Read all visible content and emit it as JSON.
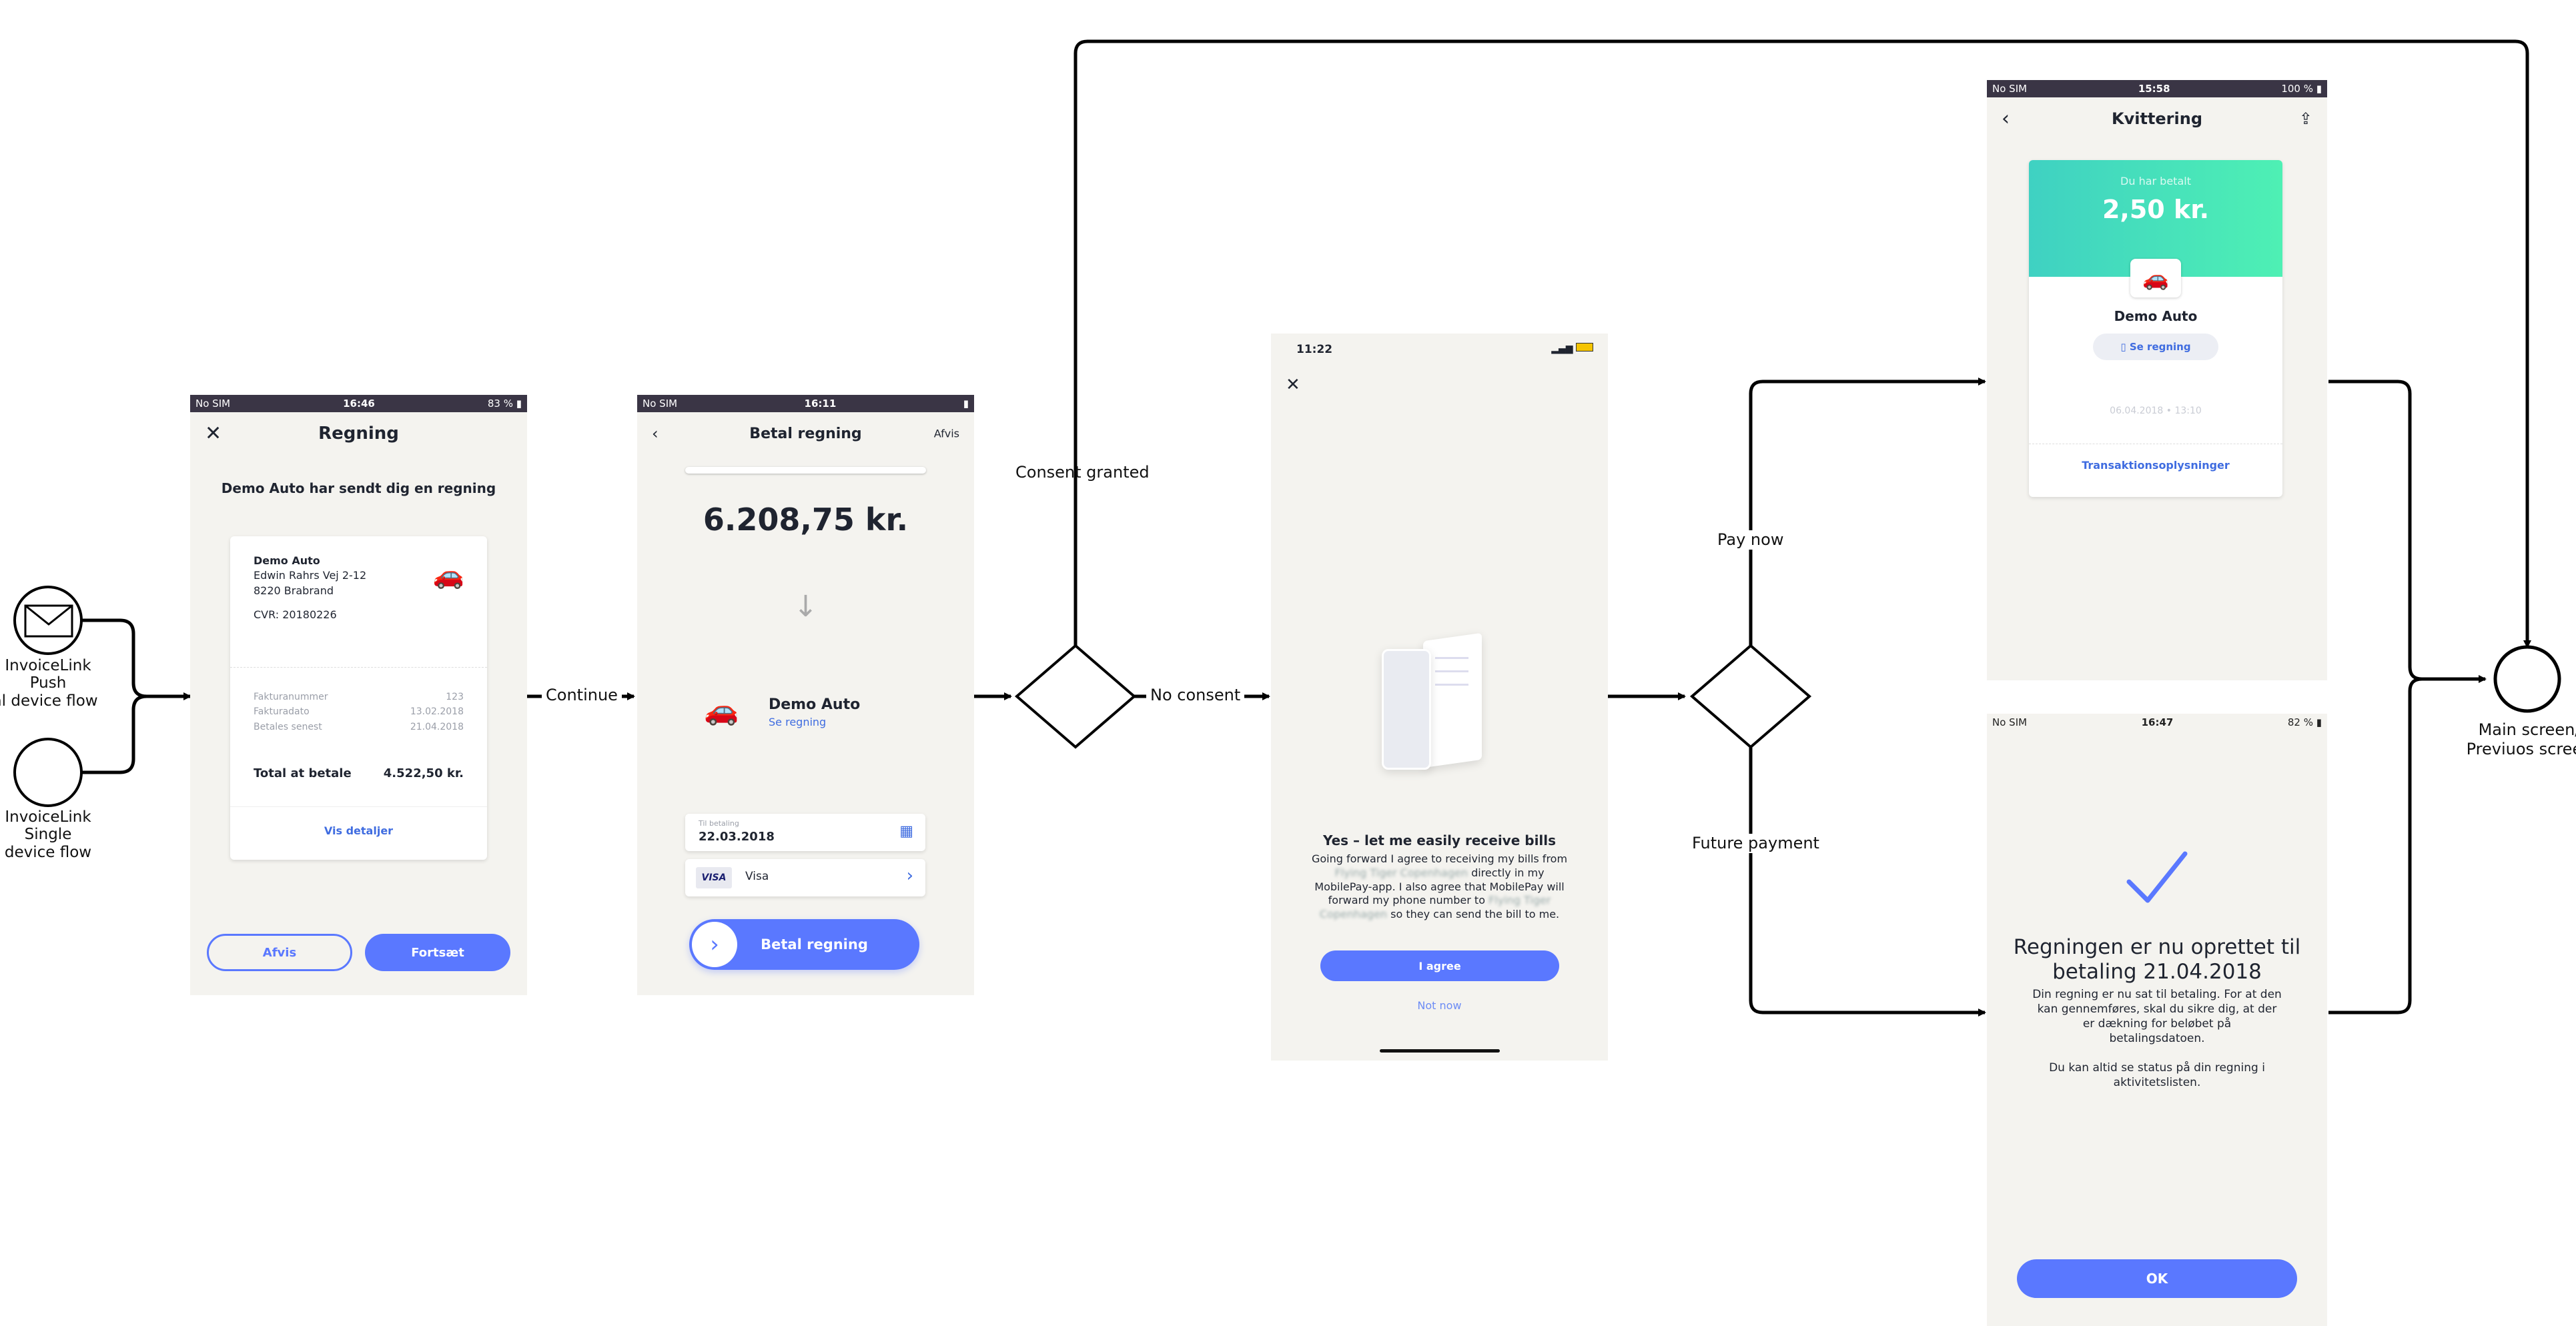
{
  "start_nodes": [
    {
      "label_lines": [
        "InvoiceLink",
        "Push",
        "ual device flow"
      ],
      "icon": "envelope-icon"
    },
    {
      "label_lines": [
        "InvoiceLink",
        "Single",
        "device flow"
      ]
    }
  ],
  "edge_labels": {
    "continue": "Continue",
    "consent_granted": "Consent granted",
    "no_consent": "No consent",
    "pay_now": "Pay now",
    "future_payment": "Future payment"
  },
  "end_node": {
    "label_lines": [
      "Main screen/",
      "Previuos screen"
    ]
  },
  "screen_regning": {
    "status": {
      "carrier": "No SIM",
      "time": "16:46",
      "battery": "83 %"
    },
    "close_icon": "close-icon",
    "title": "Regning",
    "headline": "Demo Auto har sendt dig en regning",
    "sender": {
      "name": "Demo Auto",
      "address1": "Edwin Rahrs Vej 2-12",
      "address2": "8220 Brabrand",
      "cvr": "CVR: 20180226"
    },
    "rows": [
      {
        "label": "Fakturanummer",
        "value": "123"
      },
      {
        "label": "Fakturadato",
        "value": "13.02.2018"
      },
      {
        "label": "Betales senest",
        "value": "21.04.2018"
      }
    ],
    "total_label": "Total at betale",
    "total_value": "4.522,50 kr.",
    "details_link": "Vis detaljer",
    "decline": "Afvis",
    "continue": "Fortsæt"
  },
  "screen_betal": {
    "status": {
      "carrier": "No SIM",
      "time": "16:11"
    },
    "title": "Betal regning",
    "decline": "Afvis",
    "amount": "6.208,75 kr.",
    "merchant": "Demo Auto",
    "see_bill": "Se regning",
    "date_label": "Til betaling",
    "date_value": "22.03.2018",
    "card_brand": "VISA",
    "card_name": "Visa",
    "pay_button": "Betal regning"
  },
  "screen_consent": {
    "time": "11:22",
    "title": "Yes – let me easily receive bills",
    "body_lines": [
      {
        "pre": "Going forward I agree to receiving my bills from",
        "blur": "",
        "post": ""
      },
      {
        "pre": "",
        "blur": "Flying Tiger Copenhagen",
        "post": " directly in my"
      },
      {
        "pre": "MobilePay-app. I also agree that MobilePay will",
        "blur": "",
        "post": ""
      },
      {
        "pre": "forward my phone number to ",
        "blur": "Flying Tiger",
        "post": ""
      },
      {
        "pre": "",
        "blur": "Copenhagen",
        "post": " so they can send the bill to me."
      }
    ],
    "agree": "I agree",
    "not_now": "Not now"
  },
  "screen_kvittering": {
    "status": {
      "carrier": "No SIM",
      "time": "15:58",
      "battery": "100 %"
    },
    "title": "Kvittering",
    "paid_label": "Du har betalt",
    "amount": "2,50 kr.",
    "merchant": "Demo Auto",
    "see_bill": "Se regning",
    "timestamp": "06.04.2018 • 13:10",
    "transaction_link": "Transaktionsoplysninger"
  },
  "screen_future": {
    "status": {
      "carrier": "No SIM",
      "time": "16:47",
      "battery": "82 %"
    },
    "headline_lines": [
      "Regningen er nu oprettet til",
      "betaling 21.04.2018"
    ],
    "body_lines": [
      "Din regning er nu sat til betaling. For at den",
      "kan gennemføres, skal du sikre dig, at der",
      "er dækning for beløbet på",
      "betalingsdatoen."
    ],
    "body2_lines": [
      "Du kan altid se status på din regning i",
      "aktivitetslisten."
    ],
    "ok": "OK"
  },
  "colors": {
    "accent": "#5a78ff",
    "screen_bg": "#f4f3ef",
    "status_bar": "#3a3545",
    "receipt_gradient_start": "#3fd1c2",
    "receipt_gradient_end": "#4ef0b4"
  }
}
